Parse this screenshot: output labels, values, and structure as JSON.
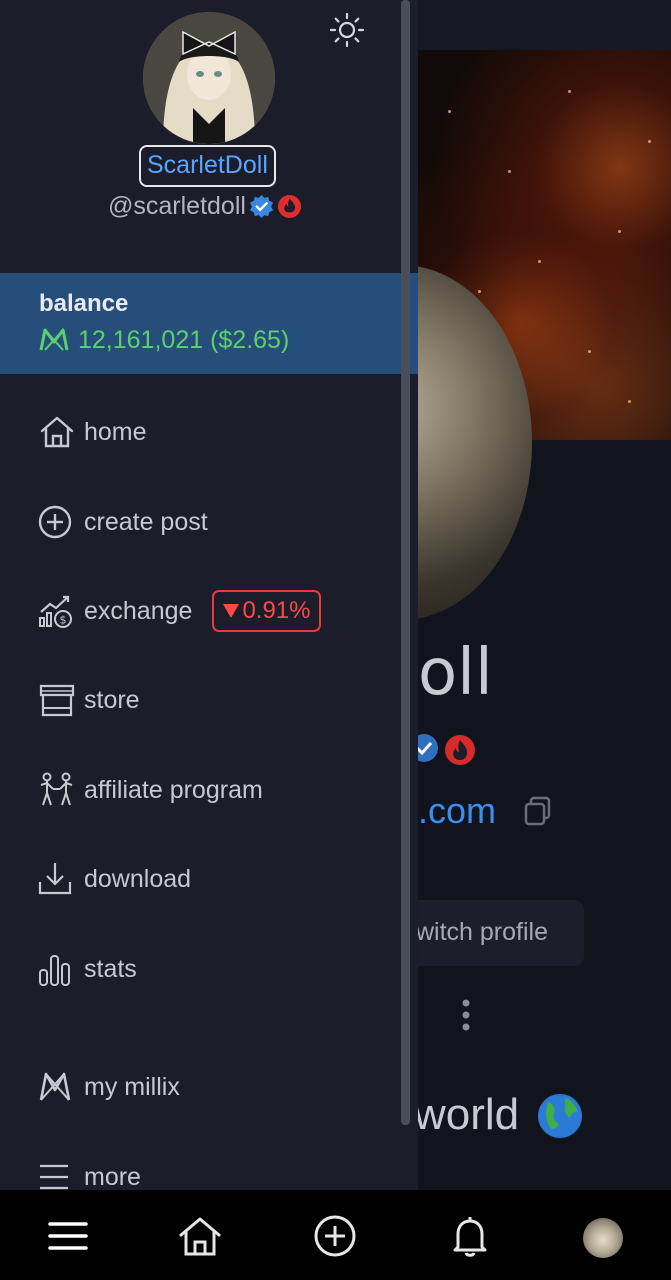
{
  "drawer": {
    "display_name": "ScarletDoll",
    "handle": "@scarletdoll",
    "balance": {
      "label": "balance",
      "amount": "12,161,021 ($2.65)"
    },
    "nav": [
      {
        "label": "home",
        "icon": "home-icon"
      },
      {
        "label": "create post",
        "icon": "plus-circle-icon"
      },
      {
        "label": "exchange",
        "icon": "exchange-chart-icon",
        "badge": "0.91%",
        "badge_direction": "down"
      },
      {
        "label": "store",
        "icon": "store-icon"
      },
      {
        "label": "affiliate program",
        "icon": "people-icon"
      },
      {
        "label": "download",
        "icon": "download-icon"
      },
      {
        "label": "stats",
        "icon": "bar-chart-icon"
      },
      {
        "label": "my millix",
        "icon": "millix-logo-icon"
      },
      {
        "label": "more",
        "icon": "menu-icon"
      }
    ]
  },
  "background_page": {
    "name_fragment": "oll",
    "link_fragment": ".com",
    "switch_profile": "witch profile",
    "bio_fragment": "world"
  },
  "bottom_bar": {
    "tabs": [
      "menu-icon",
      "home-icon",
      "plus-circle-icon",
      "bell-icon",
      "avatar"
    ]
  },
  "colors": {
    "drawer_bg": "#1b1d2a",
    "balance_bg": "#254f7a",
    "balance_green": "#5cd06f",
    "name_blue": "#5aa6ff",
    "negative_red": "#ff4747"
  }
}
